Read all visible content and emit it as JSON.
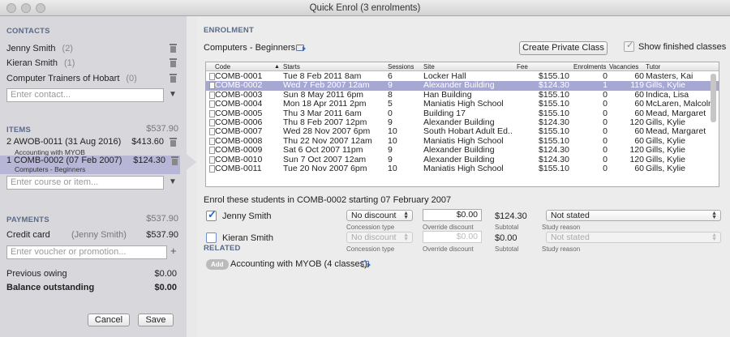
{
  "window": {
    "title": "Quick Enrol (3 enrolments)"
  },
  "contacts": {
    "heading": "CONTACTS",
    "items": [
      {
        "name": "Jenny Smith",
        "count": "(2)"
      },
      {
        "name": "Kieran Smith",
        "count": "(1)"
      },
      {
        "name": "Computer Trainers of Hobart",
        "count": "(0)"
      }
    ],
    "input_placeholder": "Enter contact..."
  },
  "items": {
    "heading": "ITEMS",
    "total": "$537.90",
    "list": [
      {
        "title": "2  AWOB-0011 (31 Aug 2016)",
        "sub": "Accounting with MYOB",
        "amount": "$413.60"
      },
      {
        "title": "1  COMB-0002 (07 Feb 2007)",
        "sub": "Computers - Beginners",
        "amount": "$124.30"
      }
    ],
    "input_placeholder": "Enter course or item..."
  },
  "payments": {
    "heading": "PAYMENTS",
    "total": "$537.90",
    "method": "Credit card",
    "payer": "(Jenny Smith)",
    "amount": "$537.90",
    "voucher_placeholder": "Enter voucher or promotion...",
    "add_symbol": "+",
    "previous_owing_label": "Previous owing",
    "previous_owing": "$0.00",
    "balance_label": "Balance outstanding",
    "balance": "$0.00"
  },
  "buttons": {
    "cancel": "Cancel",
    "save": "Save"
  },
  "enrolment": {
    "heading": "ENROLMENT",
    "course": "Computers - Beginners",
    "create_private": "Create Private Class",
    "show_finished": "Show finished classes",
    "columns": [
      "Code",
      "Starts",
      "Sessions",
      "Site",
      "Fee",
      "Enrolments",
      "Vacancies",
      "Tutor"
    ],
    "rows": [
      {
        "code": "COMB-0001",
        "starts": "Tue 8 Feb 2011 8am",
        "sessions": "6",
        "site": "Locker Hall",
        "fee": "$155.10",
        "enrol": "0",
        "vac": "60",
        "tutor": "Masters, Kai"
      },
      {
        "code": "COMB-0002",
        "starts": "Wed 7 Feb 2007 12am",
        "sessions": "9",
        "site": "Alexander Building",
        "fee": "$124.30",
        "enrol": "1",
        "vac": "119",
        "tutor": "Gills, Kylie"
      },
      {
        "code": "COMB-0003",
        "starts": "Sun 8 May 2011 6pm",
        "sessions": "8",
        "site": "Han Building",
        "fee": "$155.10",
        "enrol": "0",
        "vac": "60",
        "tutor": "Indica, Lisa"
      },
      {
        "code": "COMB-0004",
        "starts": "Mon 18 Apr 2011 2pm",
        "sessions": "5",
        "site": "Maniatis High School",
        "fee": "$155.10",
        "enrol": "0",
        "vac": "60",
        "tutor": "McLaren, Malcolm"
      },
      {
        "code": "COMB-0005",
        "starts": "Thu 3 Mar 2011 6am",
        "sessions": "0",
        "site": "Building 17",
        "fee": "$155.10",
        "enrol": "0",
        "vac": "60",
        "tutor": "Mead, Margaret"
      },
      {
        "code": "COMB-0006",
        "starts": "Thu 8 Feb 2007 12pm",
        "sessions": "9",
        "site": "Alexander Building",
        "fee": "$124.30",
        "enrol": "0",
        "vac": "120",
        "tutor": "Gills, Kylie"
      },
      {
        "code": "COMB-0007",
        "starts": "Wed 28 Nov 2007 6pm",
        "sessions": "10",
        "site": "South Hobart Adult Ed...",
        "fee": "$155.10",
        "enrol": "0",
        "vac": "60",
        "tutor": "Mead, Margaret"
      },
      {
        "code": "COMB-0008",
        "starts": "Thu 22 Nov 2007 12am",
        "sessions": "10",
        "site": "Maniatis High School",
        "fee": "$155.10",
        "enrol": "0",
        "vac": "60",
        "tutor": "Gills, Kylie"
      },
      {
        "code": "COMB-0009",
        "starts": "Sat 6 Oct 2007 11pm",
        "sessions": "9",
        "site": "Alexander Building",
        "fee": "$124.30",
        "enrol": "0",
        "vac": "120",
        "tutor": "Gills, Kylie"
      },
      {
        "code": "COMB-0010",
        "starts": "Sun 7 Oct 2007 12am",
        "sessions": "9",
        "site": "Alexander Building",
        "fee": "$124.30",
        "enrol": "0",
        "vac": "120",
        "tutor": "Gills, Kylie"
      },
      {
        "code": "COMB-0011",
        "starts": "Tue 20 Nov 2007 6pm",
        "sessions": "10",
        "site": "Maniatis High School",
        "fee": "$155.10",
        "enrol": "0",
        "vac": "60",
        "tutor": "Gills, Kylie"
      }
    ],
    "enrol_caption": "Enrol these students in COMB-0002 starting 07 February 2007",
    "students": [
      {
        "name": "Jenny Smith",
        "discount": "No discount",
        "override": "$0.00",
        "subtotal": "$124.30",
        "reason": "Not stated"
      },
      {
        "name": "Kieran Smith",
        "discount": "No discount",
        "override": "$0.00",
        "subtotal": "$0.00",
        "reason": "Not stated"
      }
    ],
    "captions": {
      "concession": "Concession type",
      "override": "Override discount",
      "subtotal": "Subtotal",
      "reason": "Study reason"
    }
  },
  "related": {
    "heading": "RELATED",
    "add_label": "Add",
    "item": "Accounting with MYOB (4 classes)"
  }
}
